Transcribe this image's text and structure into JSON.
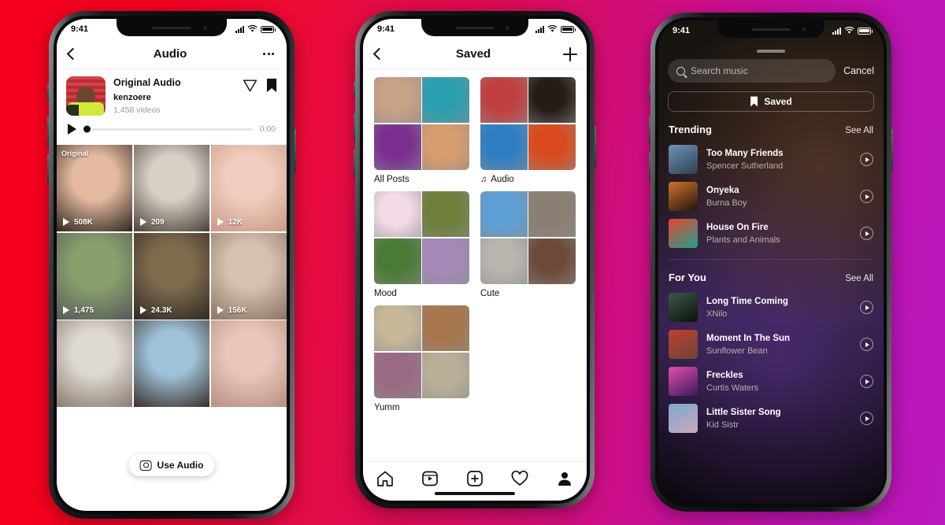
{
  "background": {
    "from": "#f4001e",
    "to": "#b818bd"
  },
  "phone_audio": {
    "status": {
      "time": "9:41",
      "signal_icon": "cellular-bars-icon",
      "wifi_icon": "wifi-icon",
      "battery_icon": "battery-icon"
    },
    "nav": {
      "back_icon": "chevron-left-icon",
      "title": "Audio",
      "more_icon": "more-options-icon"
    },
    "audio": {
      "title": "Original Audio",
      "username": "kenzoere",
      "video_count": "1,458 videos",
      "share_icon": "send-icon",
      "save_icon": "bookmark-icon",
      "play_icon": "play-icon",
      "elapsed": "0:00"
    },
    "original_badge": "Original",
    "use_audio": {
      "label": "Use Audio",
      "icon": "camera-icon"
    },
    "videos": [
      {
        "plays": "508K",
        "c1": "#e4b9a0",
        "c2": "#2e2620",
        "badge": true
      },
      {
        "plays": "209",
        "c1": "#d8cfc6",
        "c2": "#4a4038",
        "badge": false
      },
      {
        "plays": "12K",
        "c1": "#f0cdbe",
        "c2": "#c99a86",
        "badge": false
      },
      {
        "plays": "1,475",
        "c1": "#8aa06c",
        "c2": "#56595a",
        "badge": false
      },
      {
        "plays": "24.3K",
        "c1": "#7e6a4d",
        "c2": "#2f2a24",
        "badge": false
      },
      {
        "plays": "156K",
        "c1": "#d6c0ae",
        "c2": "#8a7465",
        "badge": false
      },
      {
        "plays": "",
        "c1": "#dcd8d2",
        "c2": "#8b7b6e",
        "badge": false
      },
      {
        "plays": "",
        "c1": "#9fc2d8",
        "c2": "#3a2f2a",
        "badge": false
      },
      {
        "plays": "",
        "c1": "#e8c6bb",
        "c2": "#b88f80",
        "badge": false
      }
    ]
  },
  "phone_saved": {
    "status": {
      "time": "9:41"
    },
    "nav": {
      "back_icon": "chevron-left-icon",
      "title": "Saved",
      "add_icon": "plus-icon"
    },
    "collections": [
      {
        "label": "All Posts",
        "icon": null,
        "tiles": [
          "#c8a188",
          "#2a9fb0",
          "#7a2f8f",
          "#d89d6e"
        ]
      },
      {
        "label": "Audio",
        "icon": "music-note-icon",
        "tiles": [
          "#c0403f",
          "#241c16",
          "#2f7ec4",
          "#d94b1f"
        ]
      },
      {
        "label": "Mood",
        "icon": null,
        "tiles": [
          "#f2dbe6",
          "#6d7f3a",
          "#4b7a35",
          "#a58ab8"
        ]
      },
      {
        "label": "Cute",
        "icon": null,
        "tiles": [
          "#5d9fd4",
          "#8a7f72",
          "#b9b4ae",
          "#6b4a3a"
        ]
      },
      {
        "label": "Yumm",
        "icon": null,
        "tiles": [
          "#c7b89a",
          "#a8764c",
          "#9a6a84",
          "#b9b098"
        ]
      }
    ],
    "tabbar": [
      {
        "name": "home-icon"
      },
      {
        "name": "reels-icon"
      },
      {
        "name": "create-icon"
      },
      {
        "name": "activity-heart-icon"
      },
      {
        "name": "profile-icon"
      }
    ]
  },
  "phone_music": {
    "status": {
      "time": "9:41"
    },
    "search": {
      "placeholder": "Search music",
      "value": "",
      "icon": "search-icon"
    },
    "cancel_label": "Cancel",
    "saved_button": {
      "label": "Saved",
      "icon": "bookmark-icon"
    },
    "sections": [
      {
        "title": "Trending",
        "see_all": "See All",
        "tracks": [
          {
            "name": "Too Many Friends",
            "artist": "Spencer Sutherland",
            "c1": "#6f93b8",
            "c2": "#2d3f52"
          },
          {
            "name": "Onyeka",
            "artist": "Burna Boy",
            "c1": "#d2732a",
            "c2": "#1d1410"
          },
          {
            "name": "House On Fire",
            "artist": "Plants and Animals",
            "c1": "#e8452f",
            "c2": "#1f9f8f"
          }
        ]
      },
      {
        "title": "For You",
        "see_all": "See All",
        "tracks": [
          {
            "name": "Long Time Coming",
            "artist": "XNilo",
            "c1": "#3a5a48",
            "c2": "#0d0f0d"
          },
          {
            "name": "Moment In The Sun",
            "artist": "Sunflower Bean",
            "c1": "#c0402f",
            "c2": "#6b4438"
          },
          {
            "name": "Freckles",
            "artist": "Curtis Waters",
            "c1": "#e24fa8",
            "c2": "#3a1a5e"
          },
          {
            "name": "Little Sister Song",
            "artist": "Kid Sistr",
            "c1": "#7fa8d4",
            "c2": "#c9a9b8"
          }
        ]
      }
    ],
    "play_icon": "play-circle-icon"
  }
}
